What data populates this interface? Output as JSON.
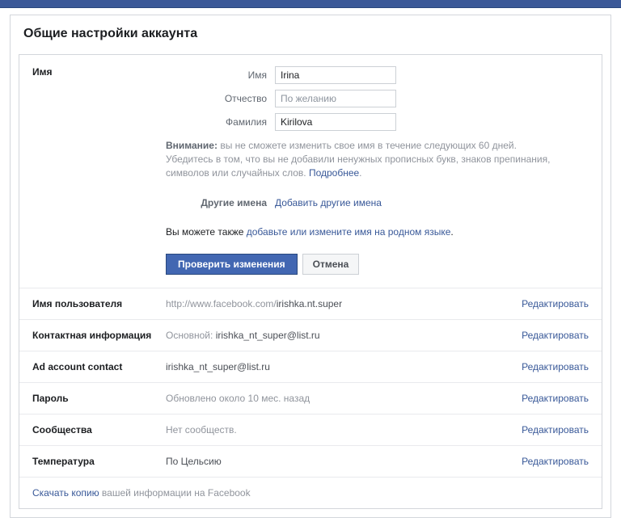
{
  "page": {
    "title": "Общие настройки аккаунта"
  },
  "name_section": {
    "heading": "Имя",
    "first_name_label": "Имя",
    "first_name_value": "Irina",
    "middle_name_label": "Отчество",
    "middle_name_placeholder": "По желанию",
    "last_name_label": "Фамилия",
    "last_name_value": "Kirilova",
    "warning_bold": "Внимание:",
    "warning_text": " вы не сможете изменить свое имя в течение следующих 60 дней. Убедитесь в том, что вы не добавили ненужных прописных букв, знаков препинания, символов или случайных слов. ",
    "warning_link": "Подробнее",
    "other_names_label": "Другие имена",
    "other_names_link": "Добавить другие имена",
    "native_prefix": "Вы можете также ",
    "native_link": "добавьте или измените имя на родном языке",
    "btn_review": "Проверить изменения",
    "btn_cancel": "Отмена"
  },
  "rows": {
    "username": {
      "label": "Имя пользователя",
      "value_prefix": "http://www.facebook.com/",
      "value_strong": "irishka.nt.super",
      "action": "Редактировать"
    },
    "contact": {
      "label": "Контактная информация",
      "value_prefix": "Основной: ",
      "value_strong": "irishka_nt_super@list.ru",
      "action": "Редактировать"
    },
    "adcontact": {
      "label": "Ad account contact",
      "value_strong": "irishka_nt_super@list.ru",
      "action": "Редактировать"
    },
    "password": {
      "label": "Пароль",
      "value": "Обновлено около 10 мес. назад",
      "action": "Редактировать"
    },
    "networks": {
      "label": "Сообщества",
      "value": "Нет сообществ.",
      "action": "Редактировать"
    },
    "temperature": {
      "label": "Температура",
      "value_strong": "По Цельсию",
      "action": "Редактировать"
    }
  },
  "download": {
    "link": "Скачать копию",
    "suffix": " вашей информации на Facebook"
  }
}
